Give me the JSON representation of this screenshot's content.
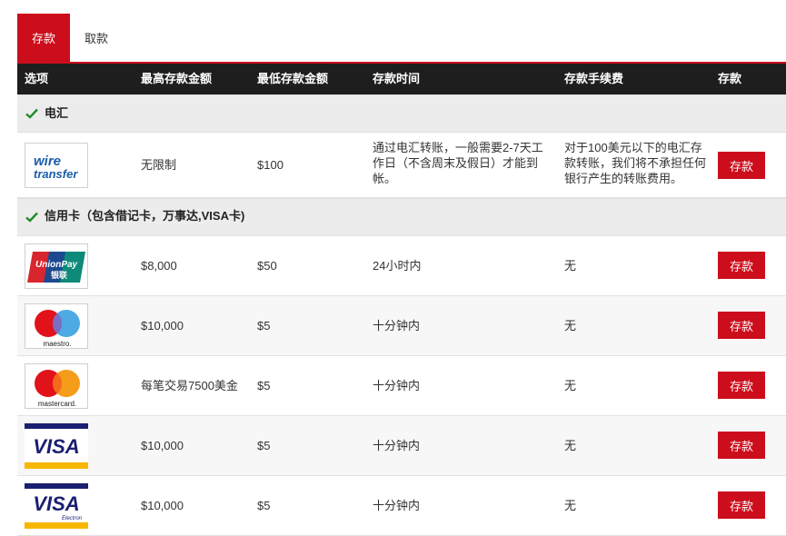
{
  "tabs": {
    "deposit": "存款",
    "withdraw": "取款"
  },
  "columns": {
    "option": "选项",
    "max": "最高存款金额",
    "min": "最低存款金额",
    "time": "存款时间",
    "fee": "存款手续费",
    "action": "存款"
  },
  "groups": {
    "wire": "电汇",
    "card": "信用卡（包含借记卡，万事达,VISA卡)"
  },
  "rows": [
    {
      "logo": "wire-transfer-logo",
      "logo_text": "wire transfer",
      "max": "无限制",
      "min": "$100",
      "time": "通过电汇转账，一般需要2-7天工作日（不含周末及假日）才能到帐。",
      "fee": "对于100美元以下的电汇存款转账，我们将不承担任何银行产生的转账费用。",
      "button": "存款"
    },
    {
      "logo": "unionpay-logo",
      "logo_text": "UnionPay 银联",
      "max": "$8,000",
      "min": "$50",
      "time": "24小时内",
      "fee": "无",
      "button": "存款"
    },
    {
      "logo": "maestro-logo",
      "logo_text": "maestro.",
      "max": "$10,000",
      "min": "$5",
      "time": "十分钟内",
      "fee": "无",
      "button": "存款"
    },
    {
      "logo": "mastercard-logo",
      "logo_text": "mastercard.",
      "max": "每笔交易7500美金",
      "min": "$5",
      "time": "十分钟内",
      "fee": "无",
      "button": "存款"
    },
    {
      "logo": "visa-logo",
      "logo_text": "VISA",
      "max": "$10,000",
      "min": "$5",
      "time": "十分钟内",
      "fee": "无",
      "button": "存款"
    },
    {
      "logo": "visa-electron-logo",
      "logo_text": "VISA Electron",
      "max": "$10,000",
      "min": "$5",
      "time": "十分钟内",
      "fee": "无",
      "button": "存款"
    }
  ],
  "colors": {
    "accent": "#cc0d1b",
    "header_bg": "#1e1e1e",
    "group_bg": "#ececec",
    "check": "#1f8a2a"
  }
}
